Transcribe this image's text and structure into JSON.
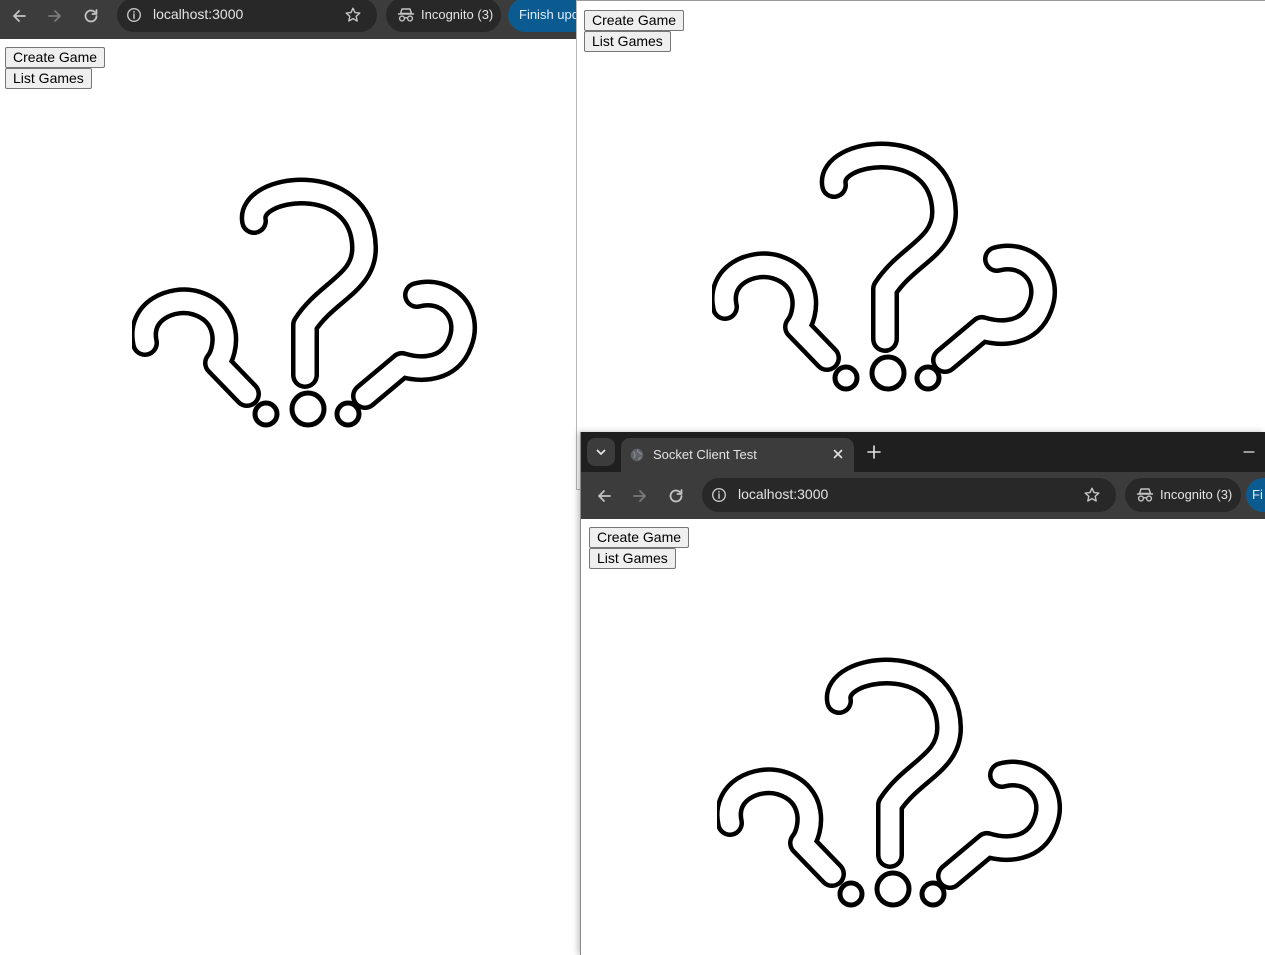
{
  "windows": [
    {
      "id": "win-a",
      "address": "localhost:3000",
      "incognito_label": "Incognito (3)",
      "update_label": "Finish upda",
      "buttons": [
        "Create Game",
        "List Games"
      ]
    },
    {
      "id": "win-b",
      "buttons": [
        "Create Game",
        "List Games"
      ]
    },
    {
      "id": "win-c",
      "tab_title": "Socket Client Test",
      "address": "localhost:3000",
      "incognito_label": "Incognito (3)",
      "update_label": "Fi",
      "buttons": [
        "Create Game",
        "List Games"
      ]
    }
  ],
  "icons": {
    "back": "arrow-left-icon",
    "forward": "arrow-right-icon",
    "reload": "reload-icon",
    "site_info": "info-icon",
    "bookmark": "star-icon",
    "incognito": "incognito-icon",
    "tab_search": "chevron-down-icon",
    "favicon": "globe-icon",
    "close_tab": "close-icon",
    "new_tab": "plus-icon",
    "minimize": "minimize-icon",
    "logo": "question-marks-logo-icon"
  },
  "colors": {
    "toolbar": "#3c3c3c",
    "tabstrip": "#1f1f1f",
    "omnibox": "#282828",
    "update_chip": "#0b5b91"
  }
}
